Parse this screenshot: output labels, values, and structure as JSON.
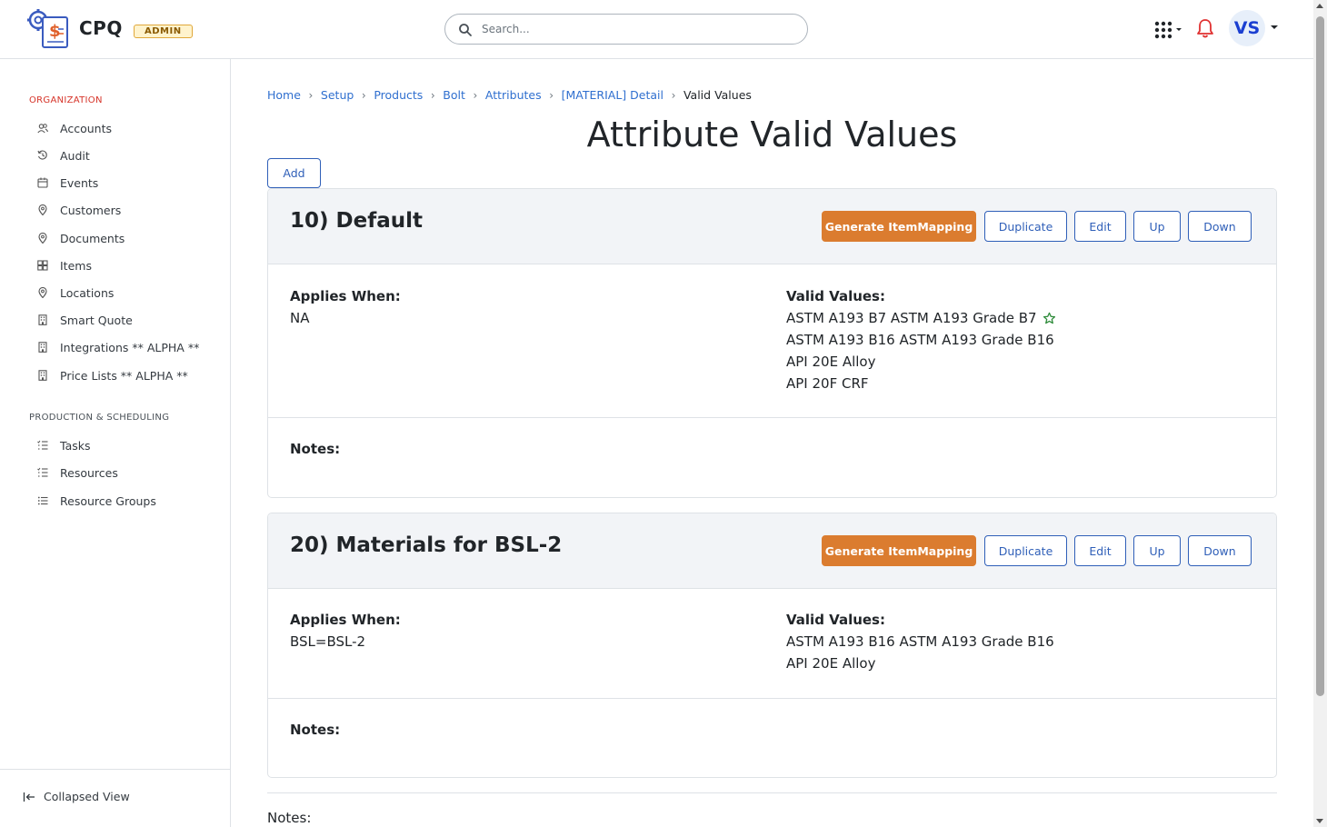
{
  "header": {
    "brand": "CPQ",
    "badge": "ADMIN",
    "search_placeholder": "Search...",
    "avatar_initials": "VS"
  },
  "sidebar": {
    "section_org": "ORGANIZATION",
    "org_items": [
      {
        "label": "Accounts",
        "icon": "users-icon"
      },
      {
        "label": "Audit",
        "icon": "history-icon"
      },
      {
        "label": "Events",
        "icon": "calendar-icon"
      },
      {
        "label": "Customers",
        "icon": "map-pin-icon"
      },
      {
        "label": "Documents",
        "icon": "map-pin-icon"
      },
      {
        "label": "Items",
        "icon": "boxes-icon"
      },
      {
        "label": "Locations",
        "icon": "map-pin-icon"
      },
      {
        "label": "Smart Quote",
        "icon": "building-icon"
      },
      {
        "label": "Integrations ** ALPHA **",
        "icon": "building-icon"
      },
      {
        "label": "Price Lists ** ALPHA **",
        "icon": "building-icon"
      }
    ],
    "section_prod": "PRODUCTION & SCHEDULING",
    "prod_items": [
      {
        "label": "Tasks",
        "icon": "list-check-icon"
      },
      {
        "label": "Resources",
        "icon": "list-check-icon"
      },
      {
        "label": "Resource Groups",
        "icon": "list-icon"
      }
    ],
    "collapse_label": "Collapsed View"
  },
  "breadcrumb": {
    "items": [
      "Home",
      "Setup",
      "Products",
      "Bolt",
      "Attributes",
      "[MATERIAL] Detail"
    ],
    "current": "Valid Values"
  },
  "main": {
    "title": "Attribute Valid Values",
    "add_label": "Add",
    "buttons": {
      "generate": "Generate ItemMapping",
      "duplicate": "Duplicate",
      "edit": "Edit",
      "up": "Up",
      "down": "Down"
    },
    "applies_label": "Applies When:",
    "valid_label": "Valid Values:",
    "notes_label": "Notes:",
    "cards": [
      {
        "title": "10) Default",
        "applies_when": "NA",
        "valid_values": [
          "ASTM A193 B7 ASTM A193 Grade B7",
          "ASTM A193 B16 ASTM A193 Grade B16",
          "API 20E Alloy",
          "API 20F CRF"
        ],
        "default_value_index": 0
      },
      {
        "title": "20) Materials for BSL-2",
        "applies_when": "BSL=BSL-2",
        "valid_values": [
          "ASTM A193 B16 ASTM A193 Grade B16",
          "API 20E Alloy"
        ]
      }
    ],
    "bottom_notes_label": "Notes:"
  },
  "colors": {
    "accent_blue": "#2f5fb8",
    "link_blue": "#2f6fcf",
    "orange": "#db7c2f",
    "section_red": "#d63328",
    "star_green": "#2e8b3a"
  }
}
